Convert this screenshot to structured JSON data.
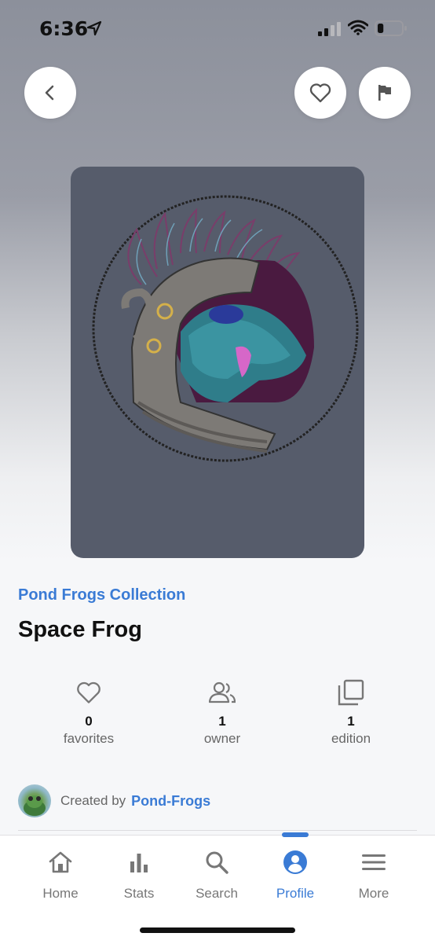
{
  "status_bar": {
    "time": "6:36",
    "battery_level": 0.25
  },
  "header": {
    "back_icon": "chevron-left-icon",
    "favorite_icon": "heart-icon",
    "flag_icon": "flag-icon"
  },
  "artwork": {
    "image": "space-frog-helmet-illustration",
    "background_color": "#565c6b"
  },
  "collection_link": "Pond Frogs Collection",
  "title": "Space Frog",
  "stats": [
    {
      "icon": "heart-icon",
      "value": "0",
      "label": "favorites"
    },
    {
      "icon": "users-icon",
      "value": "1",
      "label": "owner"
    },
    {
      "icon": "copy-icon",
      "value": "1",
      "label": "edition"
    }
  ],
  "creator": {
    "label": "Created by",
    "name": "Pond-Frogs"
  },
  "tabs": [
    {
      "icon": "home-icon",
      "label": "Home",
      "active": false
    },
    {
      "icon": "bar-chart-icon",
      "label": "Stats",
      "active": false
    },
    {
      "icon": "search-icon",
      "label": "Search",
      "active": false
    },
    {
      "icon": "profile-icon",
      "label": "Profile",
      "active": true
    },
    {
      "icon": "menu-icon",
      "label": "More",
      "active": false
    }
  ],
  "colors": {
    "accent": "#3a7bd5",
    "text_primary": "#111111",
    "text_secondary": "#666666"
  }
}
